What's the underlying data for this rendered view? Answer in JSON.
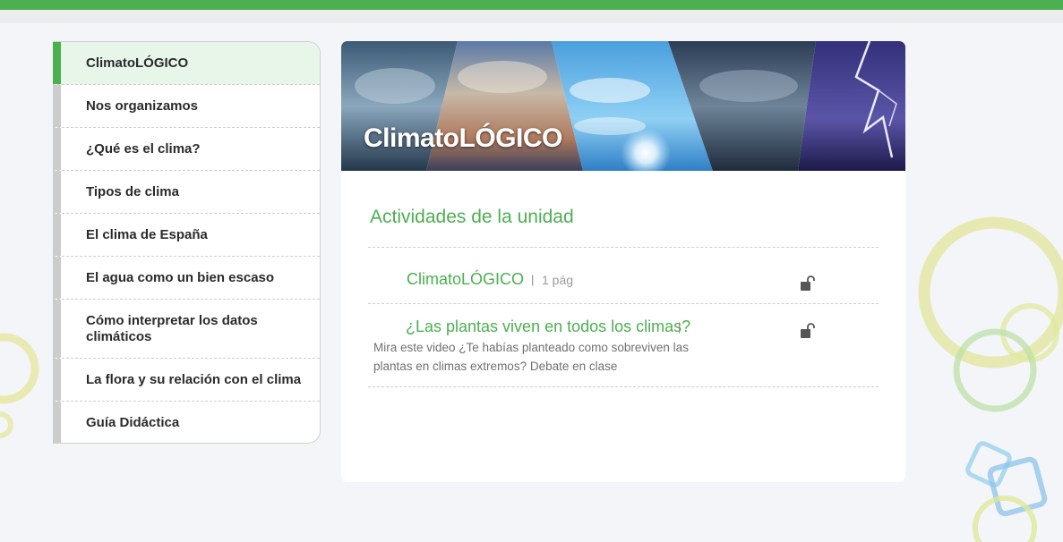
{
  "sidebar": {
    "items": [
      {
        "label": "ClimatoLÓGICO"
      },
      {
        "label": "Nos organizamos"
      },
      {
        "label": "¿Qué es el clima?"
      },
      {
        "label": "Tipos de clima"
      },
      {
        "label": "El clima de España"
      },
      {
        "label": "El agua como un bien escaso"
      },
      {
        "label": "Cómo interpretar los datos climáticos"
      },
      {
        "label": "La flora y su relación con el clima"
      },
      {
        "label": "Guía Didáctica"
      }
    ]
  },
  "banner": {
    "title": "ClimatoLÓGICO"
  },
  "section": {
    "title": "Actividades de la unidad"
  },
  "activities": [
    {
      "title": "ClimatoLÓGICO",
      "separator": "|",
      "meta": "1 pág",
      "icon": "unlocked-lock-icon"
    },
    {
      "title": "¿Las plantas viven en todos los climas?",
      "separator": "|",
      "description": "Mira este video ¿Te habías planteado como sobreviven las plantas en climas extremos? Debate en clase",
      "icon": "unlocked-lock-icon"
    }
  ],
  "colors": {
    "accent": "#4caf50",
    "inactive_bar": "#cccccc",
    "active_bg": "#e8f5e9"
  }
}
